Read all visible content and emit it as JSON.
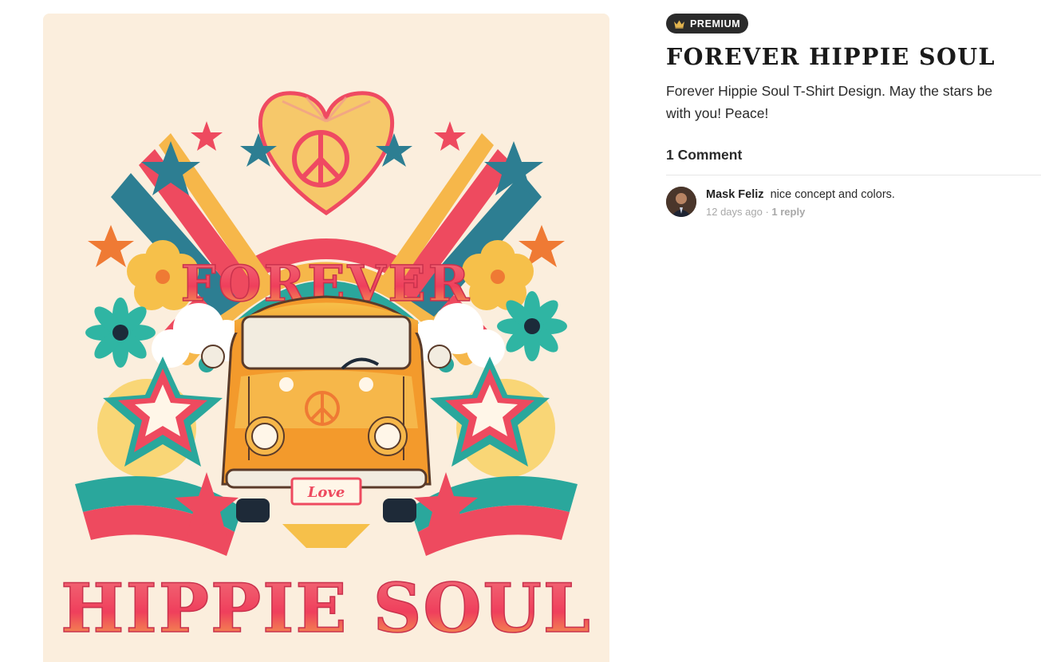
{
  "badge": {
    "icon": "crown-icon",
    "label": "PREMIUM",
    "color": "#2b2b2b",
    "icon_color": "#e2b44f"
  },
  "post": {
    "title": "FOREVER HIPPIE SOUL",
    "description": "Forever Hippie Soul T-Shirt Design. May the stars be with you! Peace!"
  },
  "artwork": {
    "top_word": "FOREVER",
    "bottom_word": "HIPPIE SOUL",
    "plate_text": "Love",
    "background": "#fbeedd"
  },
  "comments": {
    "heading": "1 Comment",
    "items": [
      {
        "author": "Mask Feliz",
        "text": "nice concept and colors.",
        "time": "12 days ago",
        "separator": " · ",
        "reply": "1 reply"
      }
    ]
  }
}
